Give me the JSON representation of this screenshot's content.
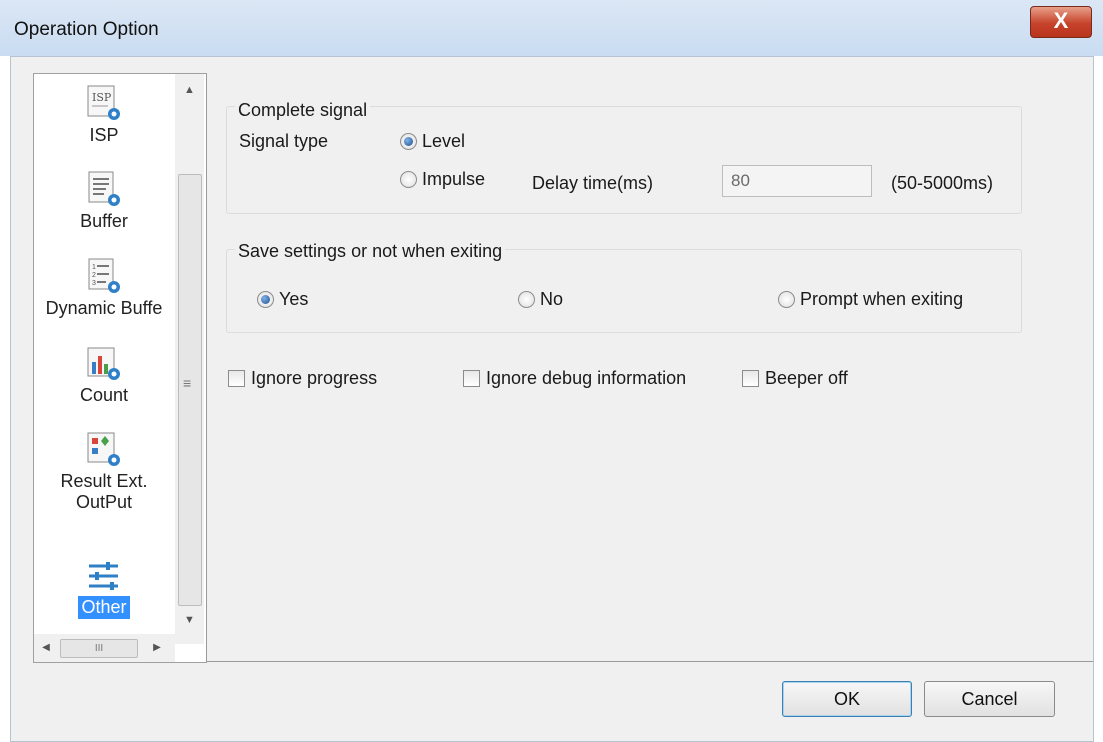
{
  "window": {
    "title": "Operation Option",
    "close_glyph": "X"
  },
  "nav": {
    "items": [
      {
        "label": "ISP",
        "icon": "isp-icon"
      },
      {
        "label": "Buffer",
        "icon": "buffer-icon"
      },
      {
        "label": "Dynamic Buffe",
        "icon": "dynamic-buffer-icon"
      },
      {
        "label": "Count",
        "icon": "count-icon"
      },
      {
        "label": "Result Ext. OutPut",
        "icon": "result-output-icon"
      },
      {
        "label": "Other",
        "icon": "other-settings-icon",
        "selected": true
      }
    ],
    "scroll_up": "▲",
    "scroll_down": "▼",
    "scroll_grip": "≡",
    "scroll_left": "◀",
    "scroll_right": "▶",
    "hscroll_grip": "III"
  },
  "complete_signal": {
    "legend": "Complete signal",
    "signal_type_label": "Signal type",
    "options": [
      "Level",
      "Impulse"
    ],
    "selected": "Level",
    "delay_label": "Delay time(ms)",
    "delay_value": "80",
    "delay_range": "(50-5000ms)"
  },
  "save_settings": {
    "legend": "Save settings or not when exiting",
    "options": [
      "Yes",
      "No",
      "Prompt when exiting"
    ],
    "selected": "Yes"
  },
  "checkboxes": [
    {
      "label": "Ignore progress",
      "checked": false
    },
    {
      "label": "Ignore debug information",
      "checked": false
    },
    {
      "label": "Beeper off",
      "checked": false
    }
  ],
  "buttons": {
    "ok": "OK",
    "cancel": "Cancel"
  },
  "colors": {
    "selection": "#3390ff",
    "close_button": "#c7432b",
    "title_bar": "#d3e2f3"
  }
}
